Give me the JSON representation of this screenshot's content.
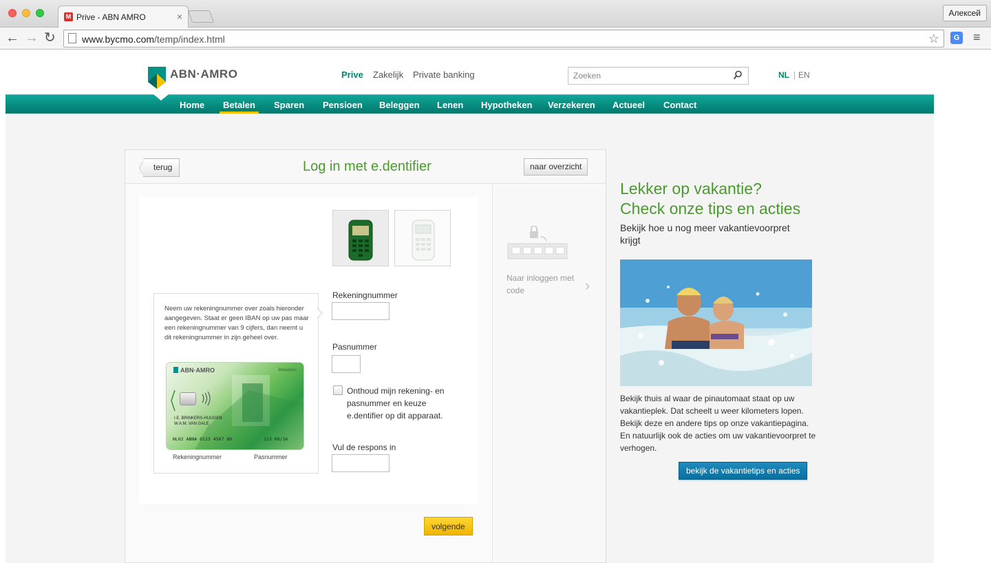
{
  "browser": {
    "tab_title": "Prive - ABN AMRO",
    "favicon_letter": "M",
    "tab_close": "×",
    "profile_name": "Алексей",
    "url_host": "www.bycmo.com",
    "url_path": "/temp/index.html",
    "back_glyph": "←",
    "forward_glyph": "→",
    "reload_glyph": "↻",
    "star_glyph": "☆",
    "menu_glyph": "≡",
    "ext_glyph": "G"
  },
  "header": {
    "logo_text": "ABN·AMRO",
    "segments": {
      "prive": "Prive",
      "zakelijk": "Zakelijk",
      "private_banking": "Private banking"
    },
    "search_placeholder": "Zoeken",
    "lang": {
      "nl": "NL",
      "sep": "|",
      "en": "EN"
    }
  },
  "nav": {
    "items": [
      "Home",
      "Betalen",
      "Sparen",
      "Pensioen",
      "Beleggen",
      "Lenen",
      "Hypotheken",
      "Verzekeren",
      "Actueel",
      "Contact"
    ],
    "active": "Betalen"
  },
  "login": {
    "back_label": "terug",
    "title": "Log in met e.dentifier",
    "overview_label": "naar overzicht",
    "hint_text": "Neem uw rekeningnummer over zoals hieronder aangegeven. Staat er geen IBAN op uw pas maar een rekeningnummer van 9 cijfers, dan neemt u dit rekeningnummer in zijn geheel over.",
    "card": {
      "logo": "ABN·AMRO",
      "type": "Betaalpas",
      "holder_line1": "I.E. BRINKERS-HUIJGEN",
      "holder_line2": "W.A.M. VAN GALE",
      "account": "NL02 ABNA 0123 4567 89",
      "pas": "123  08/16",
      "label_account": "Rekeningnummer",
      "label_pas": "Pasnummer"
    },
    "fields": {
      "account_label": "Rekeningnummer",
      "pas_label": "Pasnummer",
      "remember_label": "Onthoud mijn rekening- en pasnummer en keuze e.dentifier op dit apparaat.",
      "response_label": "Vul de respons in"
    },
    "code_link": "Naar inloggen met code",
    "next_label": "volgende"
  },
  "promo": {
    "title_line1": "Lekker op vakantie?",
    "title_line2": "Check onze tips en acties",
    "subtitle": "Bekijk hoe u nog meer vakantievoorpret krijgt",
    "body": "Bekijk thuis al waar de pinautomaat staat op uw vakantieplek. Dat scheelt u weer kilometers lopen. Bekijk deze en andere tips op onze vakantiepagina. En natuurlijk ook de acties om uw vakantievoorpret te verhogen.",
    "button": "bekijk de vakantietips en acties"
  },
  "colors": {
    "brand_green": "#00856f",
    "title_green": "#4b9a2d",
    "nav_teal": "#10a697",
    "accent_yellow": "#f5c200",
    "button_blue": "#0a6f9e"
  }
}
